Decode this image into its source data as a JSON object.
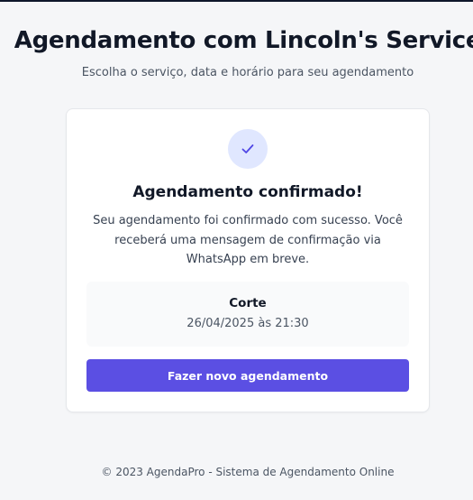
{
  "header": {
    "title": "Agendamento com Lincoln's Service",
    "subtitle": "Escolha o serviço, data e horário para seu agendamento"
  },
  "confirmation": {
    "icon": "check-icon",
    "title": "Agendamento confirmado!",
    "message": "Seu agendamento foi confirmado com sucesso. Você receberá uma mensagem de confirmação via WhatsApp em breve.",
    "summary": {
      "service": "Corte",
      "datetime": "26/04/2025 às 21:30"
    },
    "new_booking_label": "Fazer novo agendamento"
  },
  "footer": {
    "text": "© 2023 AgendaPro - Sistema de Agendamento Online"
  },
  "colors": {
    "accent": "#5b4fe3",
    "icon_bg": "#e0e7ff",
    "page_bg": "#f5f6f8"
  }
}
